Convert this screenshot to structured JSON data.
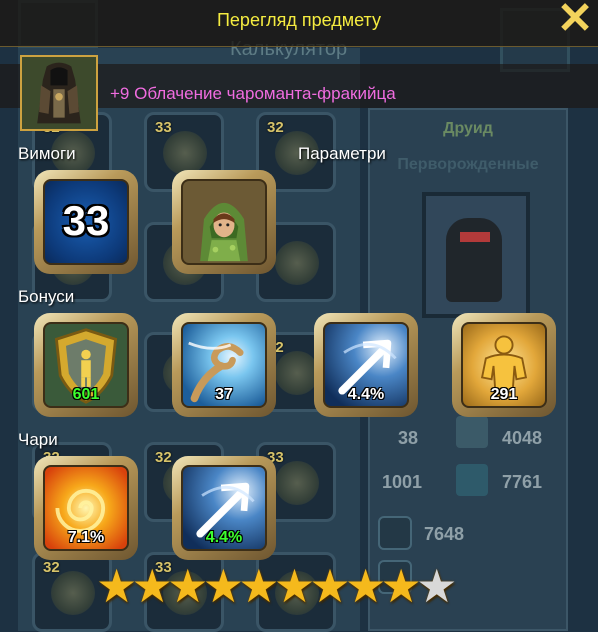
{
  "dialog": {
    "title": "Перегляд предмету",
    "close_icon": "close-x-icon"
  },
  "background": {
    "tab_title": "Калькулятор",
    "side_panel": {
      "class_name": "Друид",
      "race": "Перворожденные",
      "stats": [
        "38",
        "4048",
        "1001",
        "7761",
        "7648"
      ]
    }
  },
  "item": {
    "name": "+9 Облачение чароманта-фракийца",
    "icon": "druid-robe-icon"
  },
  "sections": {
    "requirements_label": "Вимоги",
    "parameters_label": "Параметри",
    "bonuses_label": "Бонуси",
    "enchants_label": "Чари"
  },
  "requirements": [
    {
      "icon": "level-icon",
      "value": "33"
    },
    {
      "icon": "druid-portrait-icon",
      "value": ""
    }
  ],
  "bonuses": [
    {
      "icon": "armor-shield-icon",
      "value": "601",
      "value_color": "#3dff2e"
    },
    {
      "icon": "wind-swirl-icon",
      "value": "37",
      "value_color": "#ffffff"
    },
    {
      "icon": "blue-arrow-icon",
      "value": "4.4%",
      "value_color": "#ffffff"
    },
    {
      "icon": "golden-body-icon",
      "value": "291",
      "value_color": "#ffffff"
    }
  ],
  "enchants": [
    {
      "icon": "fire-swirl-icon",
      "value": "7.1%",
      "value_color": "#ffffff"
    },
    {
      "icon": "blue-arrow-icon",
      "value": "4.4%",
      "value_color": "#3dff2e"
    }
  ],
  "stars": {
    "filled": 9,
    "total": 10,
    "filled_color": "#f5b91c",
    "empty_color": "#d8d8d8"
  }
}
